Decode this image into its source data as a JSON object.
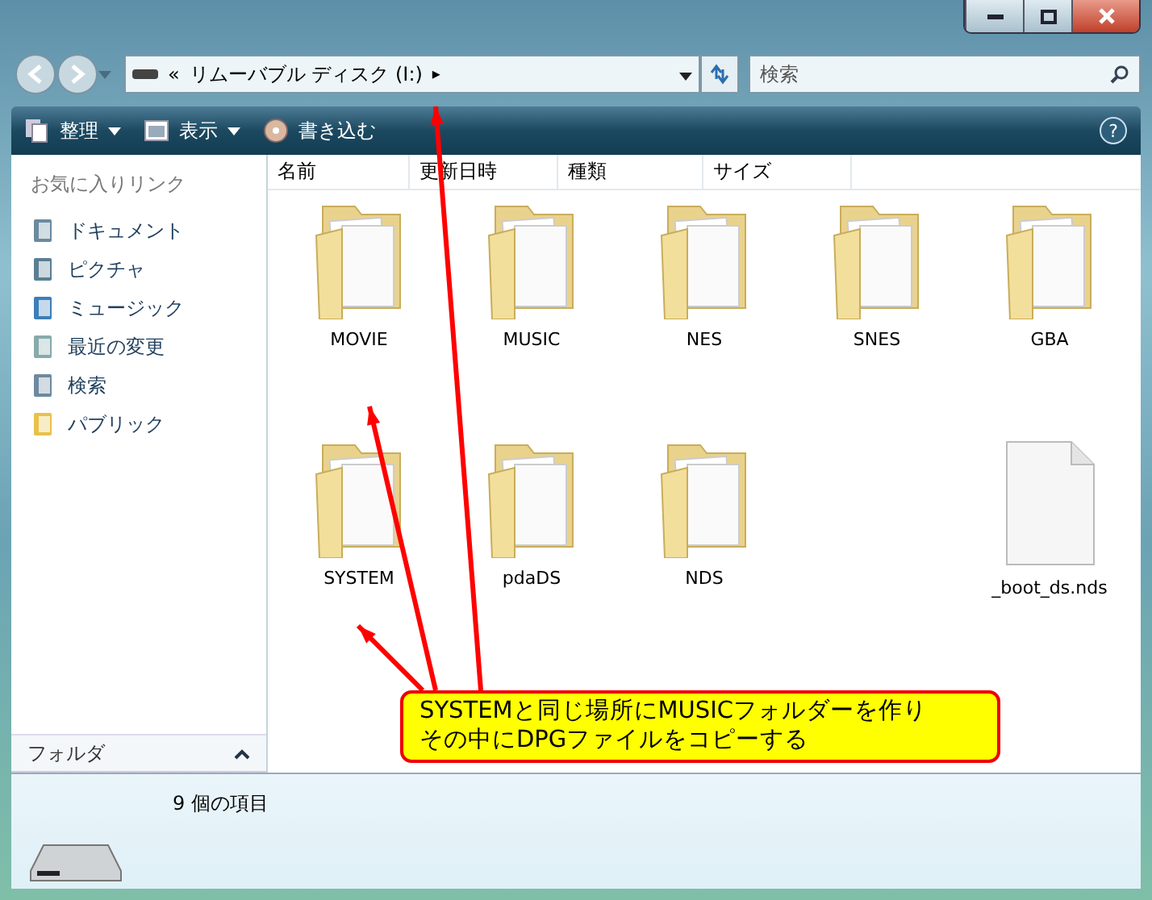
{
  "address_bar": {
    "prefix": "«",
    "path": "リムーバブル ディスク (I:)",
    "arrow": "▸"
  },
  "search": {
    "placeholder": "検索"
  },
  "toolbar": [
    {
      "label": "整理",
      "dropdown": true
    },
    {
      "label": "表示",
      "dropdown": true
    },
    {
      "label": "書き込む",
      "dropdown": false
    }
  ],
  "help": "?",
  "favorites": {
    "heading": "お気に入りリンク",
    "items": [
      {
        "label": "ドキュメント"
      },
      {
        "label": "ピクチャ"
      },
      {
        "label": "ミュージック"
      },
      {
        "label": "最近の変更"
      },
      {
        "label": "検索"
      },
      {
        "label": "パブリック"
      }
    ]
  },
  "folders_pane": {
    "label": "フォルダ",
    "expanded": false
  },
  "columns": [
    "名前",
    "更新日時",
    "種類",
    "サイズ"
  ],
  "items": [
    {
      "name": "MOVIE",
      "kind": "folder"
    },
    {
      "name": "MUSIC",
      "kind": "folder"
    },
    {
      "name": "NES",
      "kind": "folder"
    },
    {
      "name": "SNES",
      "kind": "folder"
    },
    {
      "name": "GBA",
      "kind": "folder"
    },
    {
      "name": "SYSTEM",
      "kind": "folder"
    },
    {
      "name": "pdaDS",
      "kind": "folder"
    },
    {
      "name": "NDS",
      "kind": "folder"
    },
    {
      "kind": "gap"
    },
    {
      "name": "_boot_ds.nds",
      "kind": "file"
    }
  ],
  "status_bar": {
    "count": "9 個の項目"
  },
  "callout": {
    "lines": [
      "SYSTEMと同じ場所にMUSICフォルダーを作り",
      "その中にDPGファイルをコピーする"
    ]
  }
}
